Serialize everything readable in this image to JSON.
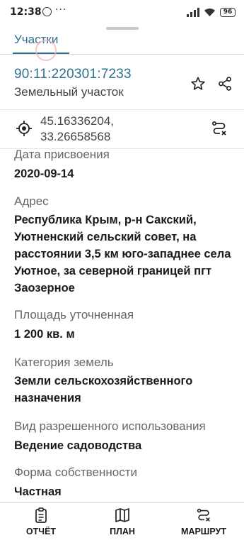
{
  "status_bar": {
    "time": "12:38",
    "dots": "···",
    "battery": "96"
  },
  "header": {
    "tab_label": "Участки"
  },
  "parcel": {
    "cadastral_number": "90:11:220301:7233",
    "type": "Земельный участок",
    "coordinates_line1": "45.16336204,",
    "coordinates_line2": "33.26658568"
  },
  "fields": {
    "assign_date": {
      "label": "Дата присвоения",
      "value": "2020-09-14"
    },
    "address": {
      "label": "Адрес",
      "value": "Республика Крым, р-н Сакский, Уютненский сельский совет, на расстоянии 3,5 км юго-западнее села Уютное, за северной границей пгт Заозерное"
    },
    "area": {
      "label": "Площадь уточненная",
      "value": "1 200 кв. м"
    },
    "category": {
      "label": "Категория земель",
      "value": "Земли сельскохозяйственного назначения"
    },
    "permitted_use": {
      "label": "Вид разрешенного использования",
      "value": "Ведение садоводства"
    },
    "ownership": {
      "label": "Форма собственности",
      "value": "Частная"
    }
  },
  "bottom_nav": {
    "report": "ОТЧЁТ",
    "plan": "ПЛАН",
    "route": "МАРШРУТ"
  },
  "colors": {
    "accent": "#2f6f8f",
    "text": "#1a1a1a",
    "muted": "#666666"
  }
}
